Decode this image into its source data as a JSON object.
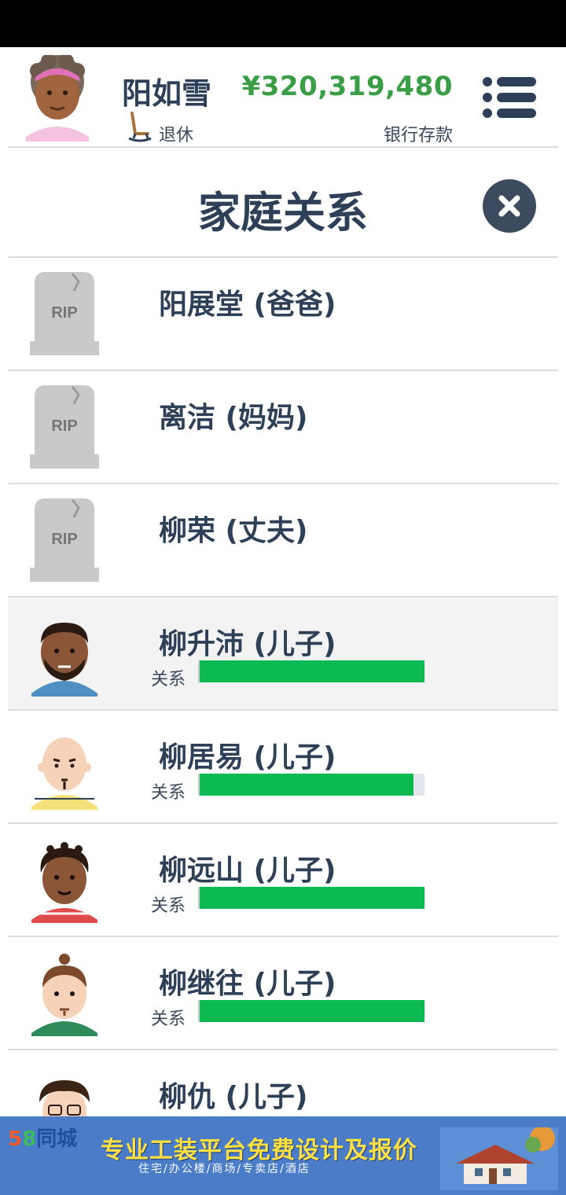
{
  "header": {
    "name": "阳如雪",
    "status": "退休",
    "money": "¥320,319,480",
    "money_label": "银行存款"
  },
  "page": {
    "title": "家庭关系"
  },
  "family": [
    {
      "name": "阳展堂 (爸爸)",
      "deceased": true
    },
    {
      "name": "离洁 (妈妈)",
      "deceased": true
    },
    {
      "name": "柳荣 (丈夫)",
      "deceased": true
    },
    {
      "name": "柳升沛 (儿子)",
      "deceased": false,
      "relation_label": "关系",
      "relation": 1.0
    },
    {
      "name": "柳居易 (儿子)",
      "deceased": false,
      "relation_label": "关系",
      "relation": 0.95
    },
    {
      "name": "柳远山 (儿子)",
      "deceased": false,
      "relation_label": "关系",
      "relation": 1.0
    },
    {
      "name": "柳继往 (儿子)",
      "deceased": false,
      "relation_label": "关系",
      "relation": 1.0
    },
    {
      "name": "柳仇 (儿子)",
      "deceased": false
    }
  ],
  "tombstone_text": "RIP",
  "ad": {
    "brand_5": "5",
    "brand_8": "8",
    "brand_rest": "同城",
    "headline": "专业工装平台免费设计及报价",
    "sub": "住宅/办公楼/商场/专卖店/酒店"
  },
  "colors": {
    "bar": "#0dba52",
    "money": "#3a9e47",
    "text": "#2e4057"
  }
}
